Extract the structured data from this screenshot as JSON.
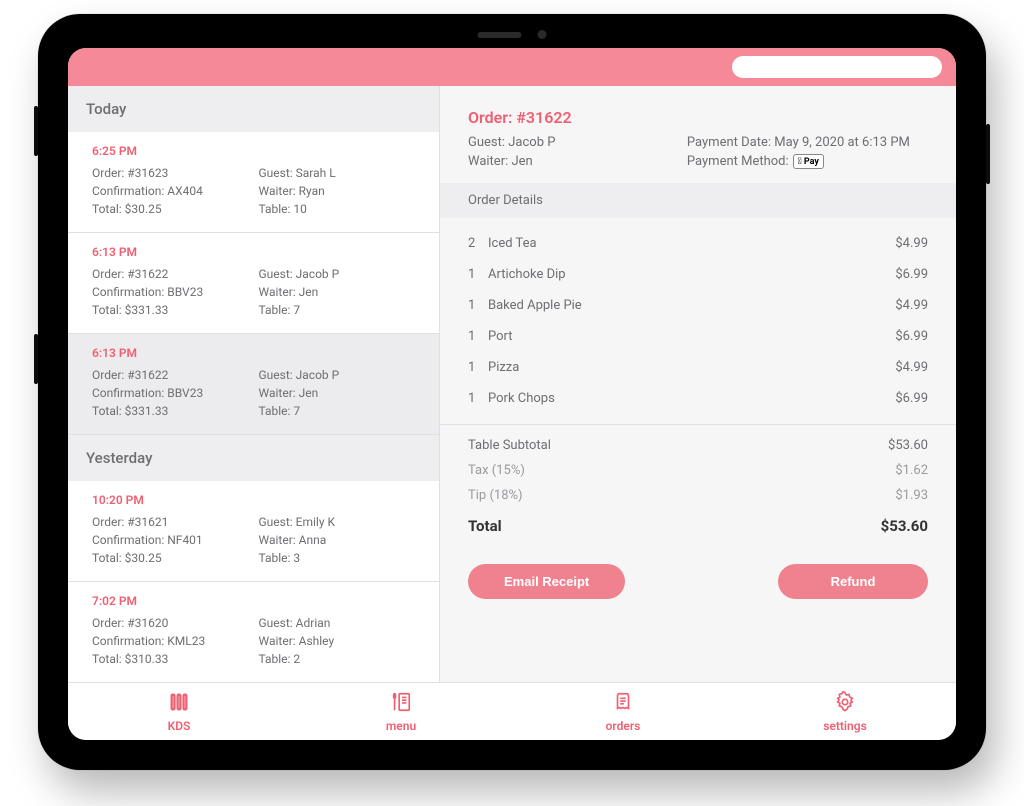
{
  "colors": {
    "accent": "#ef5f72"
  },
  "search": {
    "placeholder": ""
  },
  "groups": [
    {
      "label": "Today",
      "orders": [
        {
          "time": "6:25 PM",
          "order": "Order: #31623",
          "confirmation": "Confirmation: AX404",
          "total": "Total: $30.25",
          "guest": "Guest: Sarah L",
          "waiter": "Waiter: Ryan",
          "table": "Table: 10",
          "selected": false
        },
        {
          "time": "6:13 PM",
          "order": "Order: #31622",
          "confirmation": "Confirmation: BBV23",
          "total": "Total: $331.33",
          "guest": "Guest: Jacob P",
          "waiter": "Waiter: Jen",
          "table": "Table: 7",
          "selected": false
        },
        {
          "time": "6:13 PM",
          "order": "Order: #31622",
          "confirmation": "Confirmation: BBV23",
          "total": "Total: $331.33",
          "guest": "Guest: Jacob P",
          "waiter": "Waiter: Jen",
          "table": "Table: 7",
          "selected": true
        }
      ]
    },
    {
      "label": "Yesterday",
      "orders": [
        {
          "time": "10:20 PM",
          "order": "Order: #31621",
          "confirmation": "Confirmation: NF401",
          "total": "Total: $30.25",
          "guest": "Guest: Emily K",
          "waiter": "Waiter: Anna",
          "table": "Table: 3",
          "selected": false
        },
        {
          "time": "7:02 PM",
          "order": "Order: #31620",
          "confirmation": "Confirmation: KML23",
          "total": "Total: $310.33",
          "guest": "Guest: Adrian",
          "waiter": "Waiter: Ashley",
          "table": "Table: 2",
          "selected": false
        }
      ]
    }
  ],
  "detail": {
    "title_label": "Order: ",
    "title_number": "#31622",
    "guest": "Guest: Jacob P",
    "waiter": "Waiter: Jen",
    "payment_date": "Payment Date: May 9, 2020 at 6:13 PM",
    "payment_method_label": "Payment Method:",
    "payment_method_value": " Pay",
    "section_label": "Order Details",
    "items": [
      {
        "qty": "2",
        "name": "Iced Tea",
        "price": "$4.99"
      },
      {
        "qty": "1",
        "name": "Artichoke Dip",
        "price": "$6.99"
      },
      {
        "qty": "1",
        "name": "Baked Apple Pie",
        "price": "$4.99"
      },
      {
        "qty": "1",
        "name": "Port",
        "price": "$6.99"
      },
      {
        "qty": "1",
        "name": "Pizza",
        "price": "$4.99"
      },
      {
        "qty": "1",
        "name": "Pork Chops",
        "price": "$6.99"
      }
    ],
    "totals": [
      {
        "kind": "sub",
        "label": "Table Subtotal",
        "value": "$53.60"
      },
      {
        "kind": "light",
        "label": "Tax (15%)",
        "value": "$1.62"
      },
      {
        "kind": "light",
        "label": "Tip (18%)",
        "value": "$1.93"
      },
      {
        "kind": "grand",
        "label": "Total",
        "value": "$53.60"
      }
    ],
    "actions": {
      "email": "Email Receipt",
      "refund": "Refund"
    }
  },
  "nav": {
    "kds": "KDS",
    "menu": "menu",
    "orders": "orders",
    "settings": "settings"
  }
}
